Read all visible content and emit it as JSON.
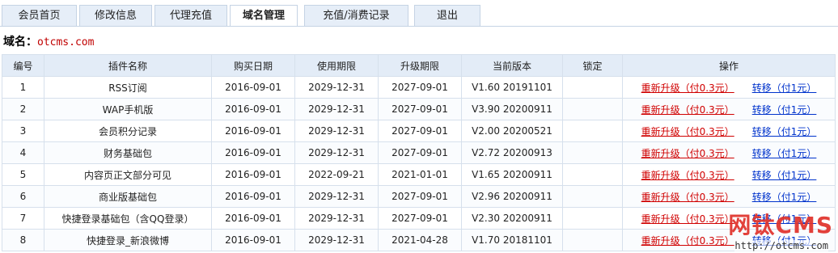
{
  "tabs": [
    {
      "label": "会员首页",
      "active": false
    },
    {
      "label": "修改信息",
      "active": false
    },
    {
      "label": "代理充值",
      "active": false
    },
    {
      "label": "域名管理",
      "active": true
    },
    {
      "label": "充值/消费记录",
      "active": false
    },
    {
      "label": "退出",
      "active": false
    }
  ],
  "domain": {
    "label": "域名：",
    "value": "otcms.com"
  },
  "table": {
    "headers": [
      "编号",
      "插件名称",
      "购买日期",
      "使用期限",
      "升级期限",
      "当前版本",
      "锁定",
      "操作"
    ],
    "rows": [
      {
        "no": "1",
        "name": "RSS订阅",
        "buy": "2016-09-01",
        "expire": "2029-12-31",
        "upgrade": "2027-09-01",
        "version": "V1.60 20191101",
        "lock": "",
        "op_upgrade": "重新升级（付0.3元）",
        "op_transfer": "转移（付1元）"
      },
      {
        "no": "2",
        "name": "WAP手机版",
        "buy": "2016-09-01",
        "expire": "2029-12-31",
        "upgrade": "2027-09-01",
        "version": "V3.90 20200911",
        "lock": "",
        "op_upgrade": "重新升级（付0.3元）",
        "op_transfer": "转移（付1元）"
      },
      {
        "no": "3",
        "name": "会员积分记录",
        "buy": "2016-09-01",
        "expire": "2029-12-31",
        "upgrade": "2027-09-01",
        "version": "V2.00 20200521",
        "lock": "",
        "op_upgrade": "重新升级（付0.3元）",
        "op_transfer": "转移（付1元）"
      },
      {
        "no": "4",
        "name": "财务基础包",
        "buy": "2016-09-01",
        "expire": "2029-12-31",
        "upgrade": "2027-09-01",
        "version": "V2.72 20200913",
        "lock": "",
        "op_upgrade": "重新升级（付0.3元）",
        "op_transfer": "转移（付1元）"
      },
      {
        "no": "5",
        "name": "内容页正文部分可见",
        "buy": "2016-09-01",
        "expire": "2022-09-21",
        "upgrade": "2021-01-01",
        "version": "V1.65 20200911",
        "lock": "",
        "op_upgrade": "重新升级（付0.3元）",
        "op_transfer": "转移（付1元）"
      },
      {
        "no": "6",
        "name": "商业版基础包",
        "buy": "2016-09-01",
        "expire": "2029-12-31",
        "upgrade": "2027-09-01",
        "version": "V2.96 20200911",
        "lock": "",
        "op_upgrade": "重新升级（付0.3元）",
        "op_transfer": "转移（付1元）"
      },
      {
        "no": "7",
        "name": "快捷登录基础包（含QQ登录）",
        "buy": "2016-09-01",
        "expire": "2029-12-31",
        "upgrade": "2027-09-01",
        "version": "V2.30 20200911",
        "lock": "",
        "op_upgrade": "重新升级（付0.3元）",
        "op_transfer": "转移（付1元）"
      },
      {
        "no": "8",
        "name": "快捷登录_新浪微博",
        "buy": "2016-09-01",
        "expire": "2029-12-31",
        "upgrade": "2021-04-28",
        "version": "V1.70 20181101",
        "lock": "",
        "op_upgrade": "重新升级（付0.3元）",
        "op_transfer": "转移（付1元）"
      }
    ]
  },
  "watermark": {
    "text": "网钛CMS",
    "url": "http://otcms.com"
  },
  "colors": {
    "tab_bg": "#e6eef8",
    "header_bg": "#e3ecf7",
    "upgrade_link": "#d00000",
    "transfer_link": "#0033cc",
    "domain_value": "#c00000",
    "watermark": "#e0312a"
  }
}
